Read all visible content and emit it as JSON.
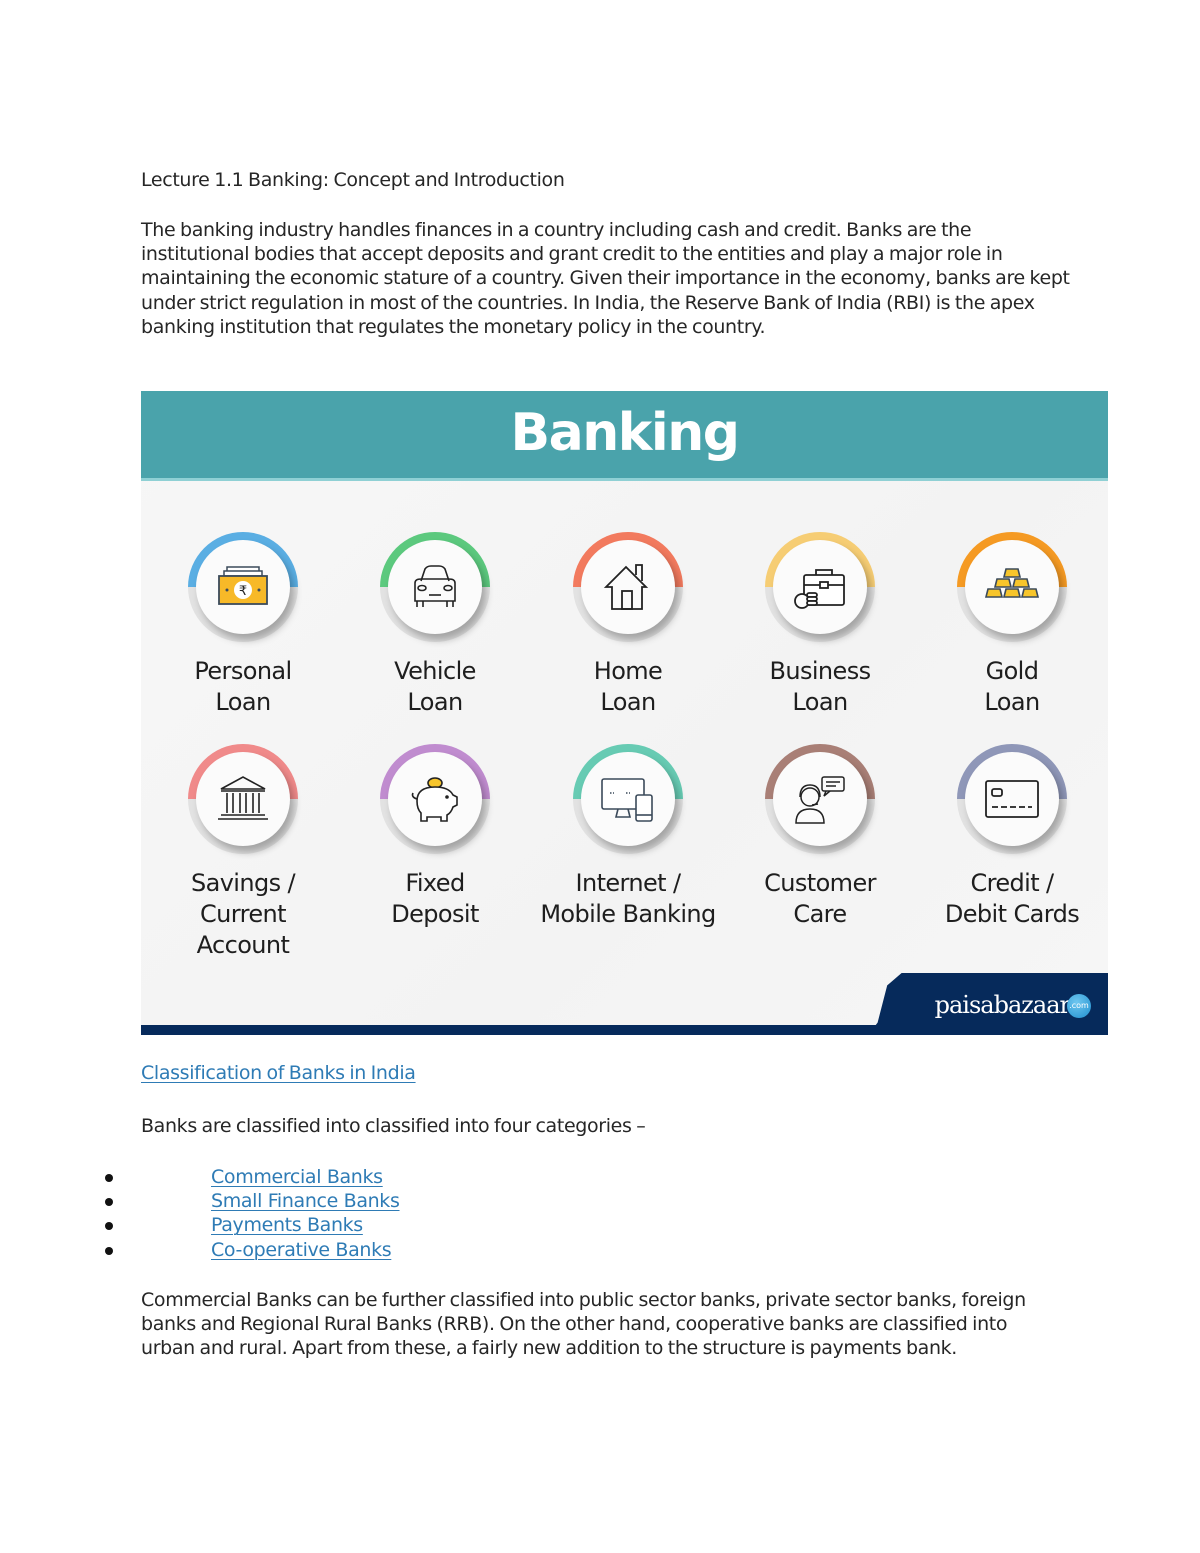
{
  "document": {
    "title": "Lecture 1.1 Banking: Concept and Introduction",
    "intro_paragraph": "The banking industry handles finances in a country including cash and credit. Banks are the institutional bodies that accept deposits and grant credit to the entities and play a major role in maintaining the economic stature of a country. Given their importance in the economy, banks are kept under strict regulation in most of the countries. In India, the Reserve Bank of India (RBI) is the apex banking institution that regulates the monetary policy in the country.",
    "classification_link": "Classification of Banks in India",
    "categories_intro": "Banks are classified into classified into four categories –",
    "categories": [
      {
        "label": "Commercial Banks"
      },
      {
        "label": "Small Finance Banks"
      },
      {
        "label": "Payments Banks"
      },
      {
        "label": "Co-operative Banks"
      }
    ],
    "closing_paragraph": "Commercial Banks can be further classified into public sector banks, private sector banks, foreign banks and Regional Rural Banks (RRB). On the other hand, cooperative banks are classified into urban and rural. Apart from these, a fairly new addition to the structure is payments bank."
  },
  "banner": {
    "title": "Banking",
    "header_color": "#4aa3ab",
    "footer_color": "#062a5b",
    "brand": "paisabazaar",
    "brand_badge": ".com",
    "services": [
      {
        "line1": "Personal",
        "line2": "Loan",
        "line3": "",
        "icon": "rupee-cash-icon",
        "ring_color": "#5aaee3"
      },
      {
        "line1": "Vehicle",
        "line2": "Loan",
        "line3": "",
        "icon": "car-icon",
        "ring_color": "#5cc97e"
      },
      {
        "line1": "Home",
        "line2": "Loan",
        "line3": "",
        "icon": "house-icon",
        "ring_color": "#f27a5e"
      },
      {
        "line1": "Business",
        "line2": "Loan",
        "line3": "",
        "icon": "briefcase-coins-icon",
        "ring_color": "#f6cd74"
      },
      {
        "line1": "Gold",
        "line2": "Loan",
        "line3": "",
        "icon": "gold-bars-icon",
        "ring_color": "#f59a23"
      },
      {
        "line1": "Savings /",
        "line2": "Current",
        "line3": "Account",
        "icon": "bank-building-icon",
        "ring_color": "#f08a8a"
      },
      {
        "line1": "Fixed",
        "line2": "Deposit",
        "line3": "",
        "icon": "piggy-bank-icon",
        "ring_color": "#c08ccf"
      },
      {
        "line1": "Internet /",
        "line2": "Mobile Banking",
        "line3": "",
        "icon": "computer-mobile-icon",
        "ring_color": "#67cbb3"
      },
      {
        "line1": "Customer",
        "line2": "Care",
        "line3": "",
        "icon": "customer-support-icon",
        "ring_color": "#a97f76"
      },
      {
        "line1": "Credit /",
        "line2": "Debit Cards",
        "line3": "",
        "icon": "credit-card-icon",
        "ring_color": "#8f97b8"
      }
    ]
  }
}
